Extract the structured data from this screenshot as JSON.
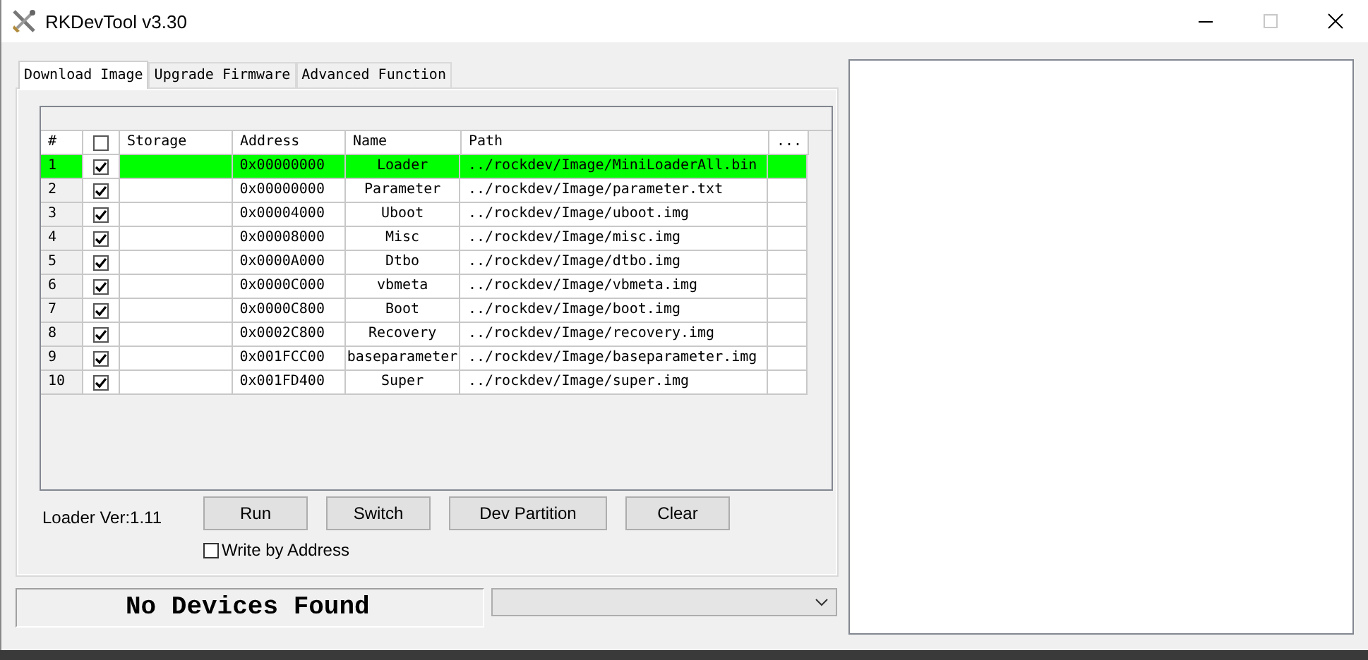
{
  "window": {
    "title": "RKDevTool v3.30",
    "maximize_disabled": true
  },
  "tabs": [
    {
      "label": "Download Image",
      "selected": true
    },
    {
      "label": "Upgrade Firmware",
      "selected": false
    },
    {
      "label": "Advanced Function",
      "selected": false
    }
  ],
  "table": {
    "columns": [
      "#",
      "Storage",
      "Address",
      "Name",
      "Path",
      "..."
    ],
    "header_checkbox": {
      "checked": false
    },
    "rows": [
      {
        "number": "1",
        "checked": true,
        "address": "0x00000000",
        "name": "Loader",
        "path": "../rockdev/Image/MiniLoaderAll.bin",
        "selected": true
      },
      {
        "number": "2",
        "checked": true,
        "address": "0x00000000",
        "name": "Parameter",
        "path": "../rockdev/Image/parameter.txt",
        "selected": false
      },
      {
        "number": "3",
        "checked": true,
        "address": "0x00004000",
        "name": "Uboot",
        "path": "../rockdev/Image/uboot.img",
        "selected": false
      },
      {
        "number": "4",
        "checked": true,
        "address": "0x00008000",
        "name": "Misc",
        "path": "../rockdev/Image/misc.img",
        "selected": false
      },
      {
        "number": "5",
        "checked": true,
        "address": "0x0000A000",
        "name": "Dtbo",
        "path": "../rockdev/Image/dtbo.img",
        "selected": false
      },
      {
        "number": "6",
        "checked": true,
        "address": "0x0000C000",
        "name": "vbmeta",
        "path": "../rockdev/Image/vbmeta.img",
        "selected": false
      },
      {
        "number": "7",
        "checked": true,
        "address": "0x0000C800",
        "name": "Boot",
        "path": "../rockdev/Image/boot.img",
        "selected": false
      },
      {
        "number": "8",
        "checked": true,
        "address": "0x0002C800",
        "name": "Recovery",
        "path": "../rockdev/Image/recovery.img",
        "selected": false
      },
      {
        "number": "9",
        "checked": true,
        "address": "0x001FCC00",
        "name": "baseparameter",
        "path": "../rockdev/Image/baseparameter.img",
        "selected": false
      },
      {
        "number": "10",
        "checked": true,
        "address": "0x001FD400",
        "name": "Super",
        "path": "../rockdev/Image/super.img",
        "selected": false
      }
    ]
  },
  "loader_version": "Loader Ver:1.11",
  "buttons": [
    "Run",
    "Switch",
    "Dev Partition",
    "Clear"
  ],
  "write_by_address": {
    "label": "Write by Address",
    "checked": false
  },
  "status": "No Devices Found"
}
